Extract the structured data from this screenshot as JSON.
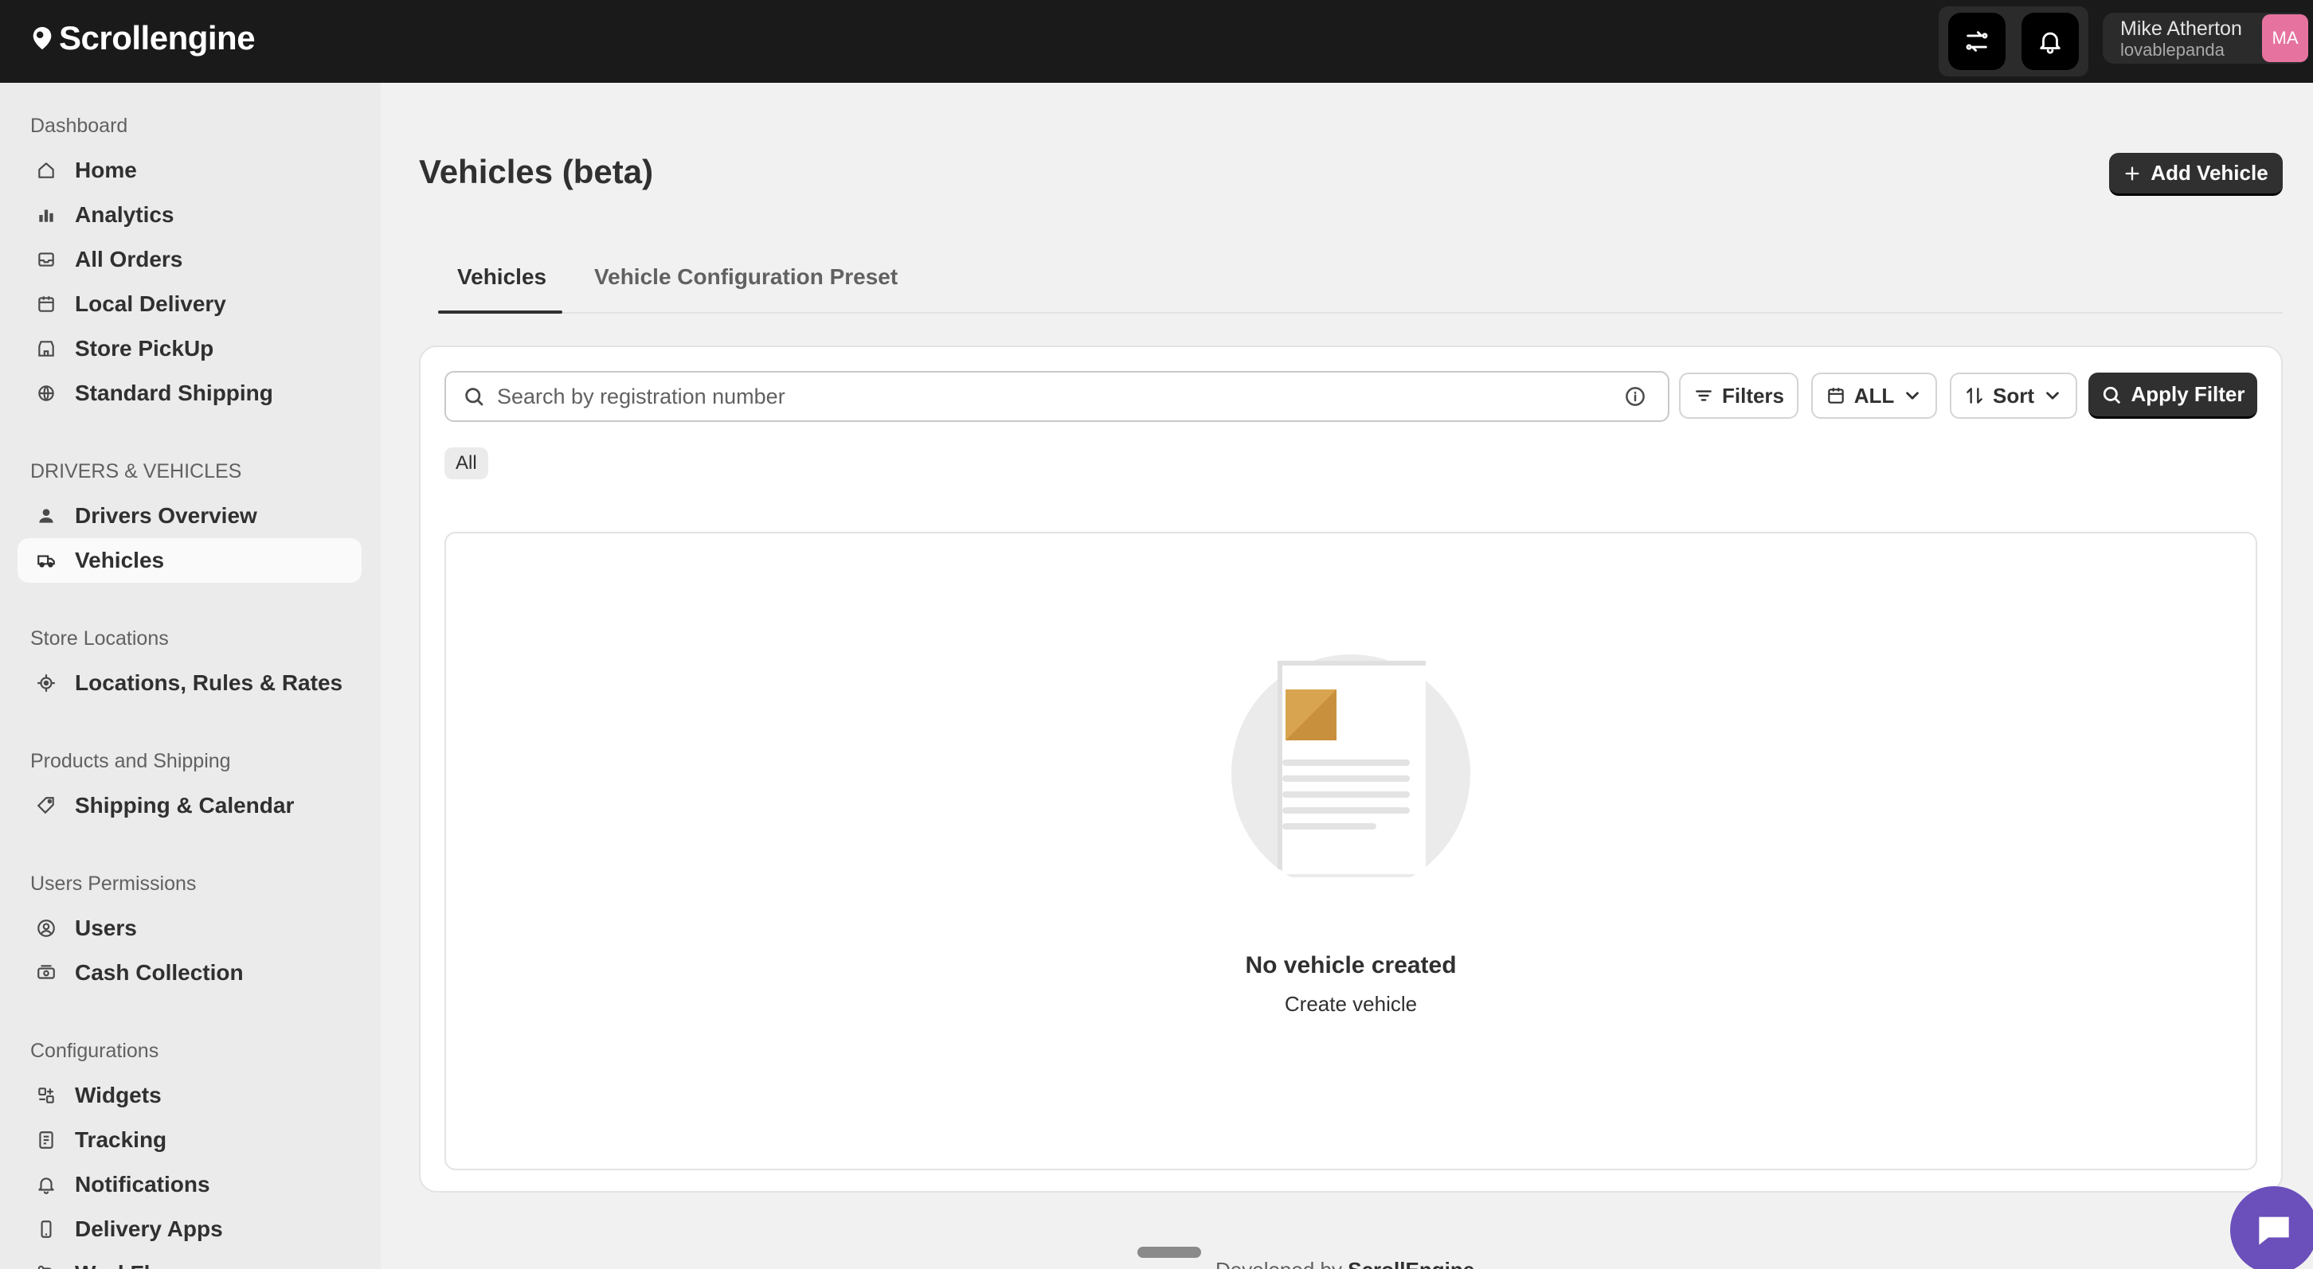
{
  "app": {
    "name": "Scrollengine"
  },
  "user": {
    "name": "Mike Atherton",
    "handle": "lovablepanda",
    "initials": "MA"
  },
  "sidebar": {
    "sections": [
      {
        "title": "Dashboard",
        "items": [
          {
            "label": "Home",
            "icon": "home-icon"
          },
          {
            "label": "Analytics",
            "icon": "bar-chart-icon"
          },
          {
            "label": "All Orders",
            "icon": "inbox-icon"
          },
          {
            "label": "Local Delivery",
            "icon": "calendar-icon"
          },
          {
            "label": "Store PickUp",
            "icon": "store-icon"
          },
          {
            "label": "Standard Shipping",
            "icon": "globe-icon"
          }
        ]
      },
      {
        "title": "DRIVERS & VEHICLES",
        "items": [
          {
            "label": "Drivers Overview",
            "icon": "person-icon"
          },
          {
            "label": "Vehicles",
            "icon": "truck-icon",
            "active": true
          }
        ]
      },
      {
        "title": "Store Locations",
        "items": [
          {
            "label": "Locations, Rules & Rates",
            "icon": "target-icon"
          }
        ]
      },
      {
        "title": "Products and Shipping",
        "items": [
          {
            "label": "Shipping & Calendar",
            "icon": "tag-icon"
          }
        ]
      },
      {
        "title": "Users Permissions",
        "items": [
          {
            "label": "Users",
            "icon": "user-circle-icon"
          },
          {
            "label": "Cash Collection",
            "icon": "cash-icon"
          }
        ]
      },
      {
        "title": "Configurations",
        "items": [
          {
            "label": "Widgets",
            "icon": "widgets-icon"
          },
          {
            "label": "Tracking",
            "icon": "tracking-icon"
          },
          {
            "label": "Notifications",
            "icon": "bell-icon"
          },
          {
            "label": "Delivery Apps",
            "icon": "mobile-icon"
          },
          {
            "label": "WorkFlow",
            "icon": "workflow-icon"
          }
        ]
      }
    ]
  },
  "page": {
    "title": "Vehicles (beta)",
    "add_button": "Add Vehicle",
    "tabs": [
      "Vehicles",
      "Vehicle Configuration Preset"
    ]
  },
  "filters": {
    "search_placeholder": "Search by registration number",
    "filters_label": "Filters",
    "date_label": "ALL",
    "sort_label": "Sort",
    "apply_label": "Apply Filter",
    "chip": "All"
  },
  "empty_state": {
    "title": "No vehicle created",
    "subtitle": "Create vehicle"
  },
  "footer": {
    "prefix": "Developed by ",
    "brand": "ScrollEngine"
  },
  "colors": {
    "topbar": "#1a1a1a",
    "primary_button": "#303030",
    "avatar": "#e6739f",
    "chat": "#6b4fbb"
  }
}
